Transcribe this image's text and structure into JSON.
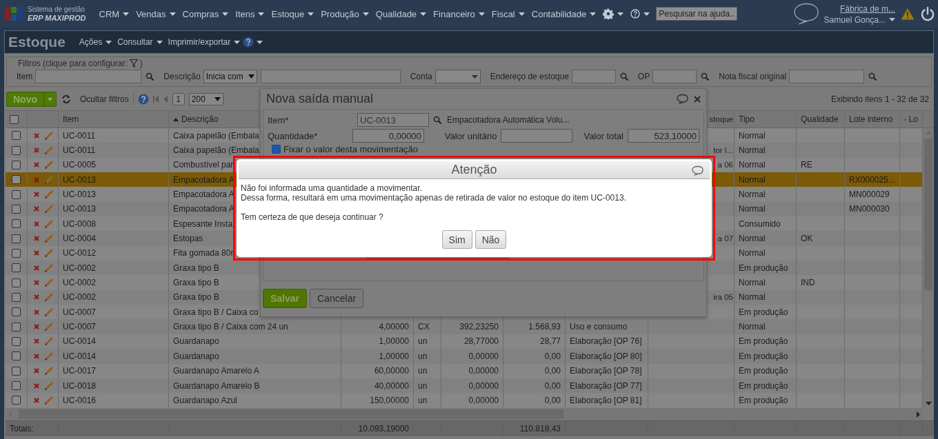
{
  "app": {
    "system_label": "Sistema de gestão",
    "product_name": "ERP MAXIPROD"
  },
  "menu": [
    {
      "label": "CRM"
    },
    {
      "label": "Vendas"
    },
    {
      "label": "Compras"
    },
    {
      "label": "Itens"
    },
    {
      "label": "Estoque"
    },
    {
      "label": "Produção"
    },
    {
      "label": "Qualidade"
    },
    {
      "label": "Financeiro"
    },
    {
      "label": "Fiscal"
    },
    {
      "label": "Contabilidade"
    }
  ],
  "help_search": {
    "placeholder": "Pesquisar na ajuda..."
  },
  "user": {
    "company": "Fábrica de m...",
    "name": "Samuel Gonça..."
  },
  "page": {
    "title": "Estoque",
    "actions": [
      "Ações",
      "Consultar",
      "Imprimir/exportar"
    ]
  },
  "filters": {
    "legend_start": "Filtros (clique para configurar:",
    "legend_end": ")",
    "fields": [
      {
        "kind": "text",
        "label": "Item",
        "search": true
      },
      {
        "kind": "select_text",
        "label": "Descrição",
        "value": "Inicia com"
      },
      {
        "kind": "select",
        "label": "Conta"
      },
      {
        "kind": "text",
        "label": "Endereço de estoque",
        "search": true
      },
      {
        "kind": "text",
        "label": "OP",
        "search": true
      },
      {
        "kind": "text",
        "label": "Nota fiscal original",
        "search": true
      }
    ]
  },
  "toolbar": {
    "new_button": "Novo",
    "hide_filters": "Ocultar filtros",
    "page": "1",
    "page_size": "200",
    "summary": "Exibindo itens 1 - 32 de 32"
  },
  "table": {
    "header_checked": false,
    "columns": [
      {
        "label": "Item",
        "kind": "text",
        "sorted": false
      },
      {
        "label": "Descrição",
        "kind": "text",
        "sorted": true
      },
      {
        "kind": "number"
      },
      {
        "kind": "text"
      },
      {
        "kind": "number"
      },
      {
        "kind": "number"
      },
      {
        "kind": "text"
      },
      {
        "label": "stoque",
        "kind": "clipped"
      },
      {
        "label": "Tipo",
        "kind": "text",
        "sorted": false
      },
      {
        "label": "Qualidade",
        "kind": "text",
        "sorted": false
      },
      {
        "label": "Lote interno",
        "kind": "text",
        "sorted": false
      },
      {
        "label": "Lo",
        "kind": "text",
        "sorted": true
      }
    ],
    "rows": [
      {
        "checked": false,
        "selected": false,
        "item": "UC-0011",
        "descricao": "Caixa papelão (Embala",
        "tipo": "Normal"
      },
      {
        "checked": false,
        "selected": false,
        "item": "UC-0011",
        "descricao": "Caixa papelão (Embala",
        "column_10": "tor l...",
        "tipo": "Normal"
      },
      {
        "checked": false,
        "selected": false,
        "item": "UC-0005",
        "descricao": "Combustível par",
        "column_10": "a 06",
        "tipo": "Normal",
        "qualidade": "RE"
      },
      {
        "checked": false,
        "selected": true,
        "item": "UC-0013",
        "descricao": "Empacotadora A",
        "tipo": "Normal",
        "lote_interno": "RX000025..."
      },
      {
        "checked": false,
        "selected": false,
        "item": "UC-0013",
        "descricao": "Empacotadora A",
        "tipo": "Normal",
        "lote_interno": "MN000029"
      },
      {
        "checked": false,
        "selected": false,
        "item": "UC-0013",
        "descricao": "Empacotadora A",
        "tipo": "Normal",
        "lote_interno": "MN000030"
      },
      {
        "checked": false,
        "selected": false,
        "item": "UC-0008",
        "descricao": "Espesante Insta",
        "tipo": "Consumido"
      },
      {
        "checked": false,
        "selected": false,
        "item": "UC-0004",
        "descricao": "Estopas",
        "column_10": "a 07",
        "tipo": "Normal",
        "qualidade": "OK"
      },
      {
        "checked": false,
        "selected": false,
        "item": "UC-0012",
        "descricao": "Fita gomada 80r",
        "tipo": "Normal"
      },
      {
        "checked": false,
        "selected": false,
        "item": "UC-0002",
        "descricao": "Graxa tipo B",
        "tipo": "Em produção"
      },
      {
        "checked": false,
        "selected": false,
        "item": "UC-0002",
        "descricao": "Graxa tipo B",
        "tipo": "Normal",
        "qualidade": "IND"
      },
      {
        "checked": false,
        "selected": false,
        "item": "UC-0002",
        "descricao": "Graxa tipo B",
        "column_10": "ira 05",
        "tipo": "Normal"
      },
      {
        "checked": false,
        "selected": false,
        "item": "UC-0007",
        "descricao": "Graxa tipo B / Caixa co",
        "tipo": "Em produção"
      },
      {
        "checked": false,
        "selected": false,
        "item": "UC-0007",
        "descricao": "Graxa tipo B / Caixa com 24 un",
        "column_5": "4,00000",
        "column_6": "CX",
        "column_7": "392,23250",
        "column_8": "1.568,93",
        "column_9": "Uso e consumo",
        "tipo": "Normal"
      },
      {
        "checked": false,
        "selected": false,
        "item": "UC-0014",
        "descricao": "Guardanapo",
        "column_5": "1,00000",
        "column_6": "un",
        "column_7": "28,77000",
        "column_8": "28,77",
        "column_9": "Elaboração [OP 76]",
        "tipo": "Em produção"
      },
      {
        "checked": false,
        "selected": false,
        "item": "UC-0014",
        "descricao": "Guardanapo",
        "column_5": "1,00000",
        "column_6": "un",
        "column_7": "0,00000",
        "column_8": "0,00",
        "column_9": "Elaboração [OP 80]",
        "tipo": "Em produção"
      },
      {
        "checked": false,
        "selected": false,
        "item": "UC-0017",
        "descricao": "Guardanapo Amarelo A",
        "column_5": "60,00000",
        "column_6": "un",
        "column_7": "0,00000",
        "column_8": "0,00",
        "column_9": "Elaboração [OP 78]",
        "tipo": "Em produção"
      },
      {
        "checked": false,
        "selected": false,
        "item": "UC-0018",
        "descricao": "Guardanapo Amarelo B",
        "column_5": "40,00000",
        "column_6": "un",
        "column_7": "0,00000",
        "column_8": "0,00",
        "column_9": "Elaboração [OP 77]",
        "tipo": "Em produção"
      },
      {
        "checked": false,
        "selected": false,
        "item": "UC-0016",
        "descricao": "Guardanapo Azul",
        "column_5": "150,00000",
        "column_6": "un",
        "column_7": "0,00000",
        "column_8": "0,00",
        "column_9": "Elaboração [OP 81]",
        "tipo": "Em produção"
      }
    ],
    "totals": {
      "label": "Totais:",
      "column_5": "10.093,19000",
      "column_8": "110.818,43"
    }
  },
  "entry_dialog": {
    "title": "Nova saída manual",
    "item": {
      "label": "Item*",
      "value": "UC-0013",
      "description": "Empacotadora Automática Volu..."
    },
    "quantity": {
      "label": "Quantidade*",
      "value": "0,00000"
    },
    "unit_value": {
      "label": "Valor unitário"
    },
    "total_value": {
      "label": "Valor total",
      "value": "523,10000"
    },
    "fix_value": {
      "label": "Fixar o valor desta movimentação",
      "checked": true
    },
    "buttons": [
      {
        "label": "Salvar",
        "kind": "primary"
      },
      {
        "label": "Cancelar",
        "kind": "secondary"
      }
    ]
  },
  "alert": {
    "title": "Atenção",
    "message": [
      "Não foi informada uma quantidade a movimentar.\nDessa forma, resultará em uma movimentação apenas de retirada de valor no estoque do item UC-0013.",
      "Tem certeza de que deseja continuar ?"
    ],
    "buttons": [
      {
        "label": "Sim"
      },
      {
        "label": "Não"
      }
    ]
  }
}
